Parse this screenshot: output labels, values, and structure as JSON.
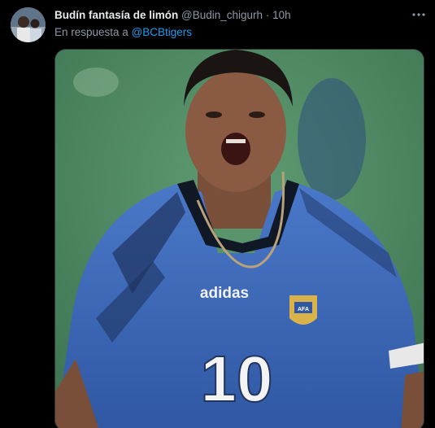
{
  "tweet": {
    "author_name": "Budín fantasía de limón",
    "author_handle": "@Budin_chigurh",
    "separator": "·",
    "time": "10h",
    "reply_prefix": "En respuesta a",
    "reply_to": "@BCBtigers",
    "more_icon": "ellipsis-icon"
  },
  "media": {
    "jersey_brand": "adidas",
    "jersey_number": "10",
    "badge_text": "AFA"
  },
  "colors": {
    "background": "#000000",
    "text": "#e7e9ea",
    "muted": "#8b98a5",
    "accent": "#1d9bf0"
  }
}
